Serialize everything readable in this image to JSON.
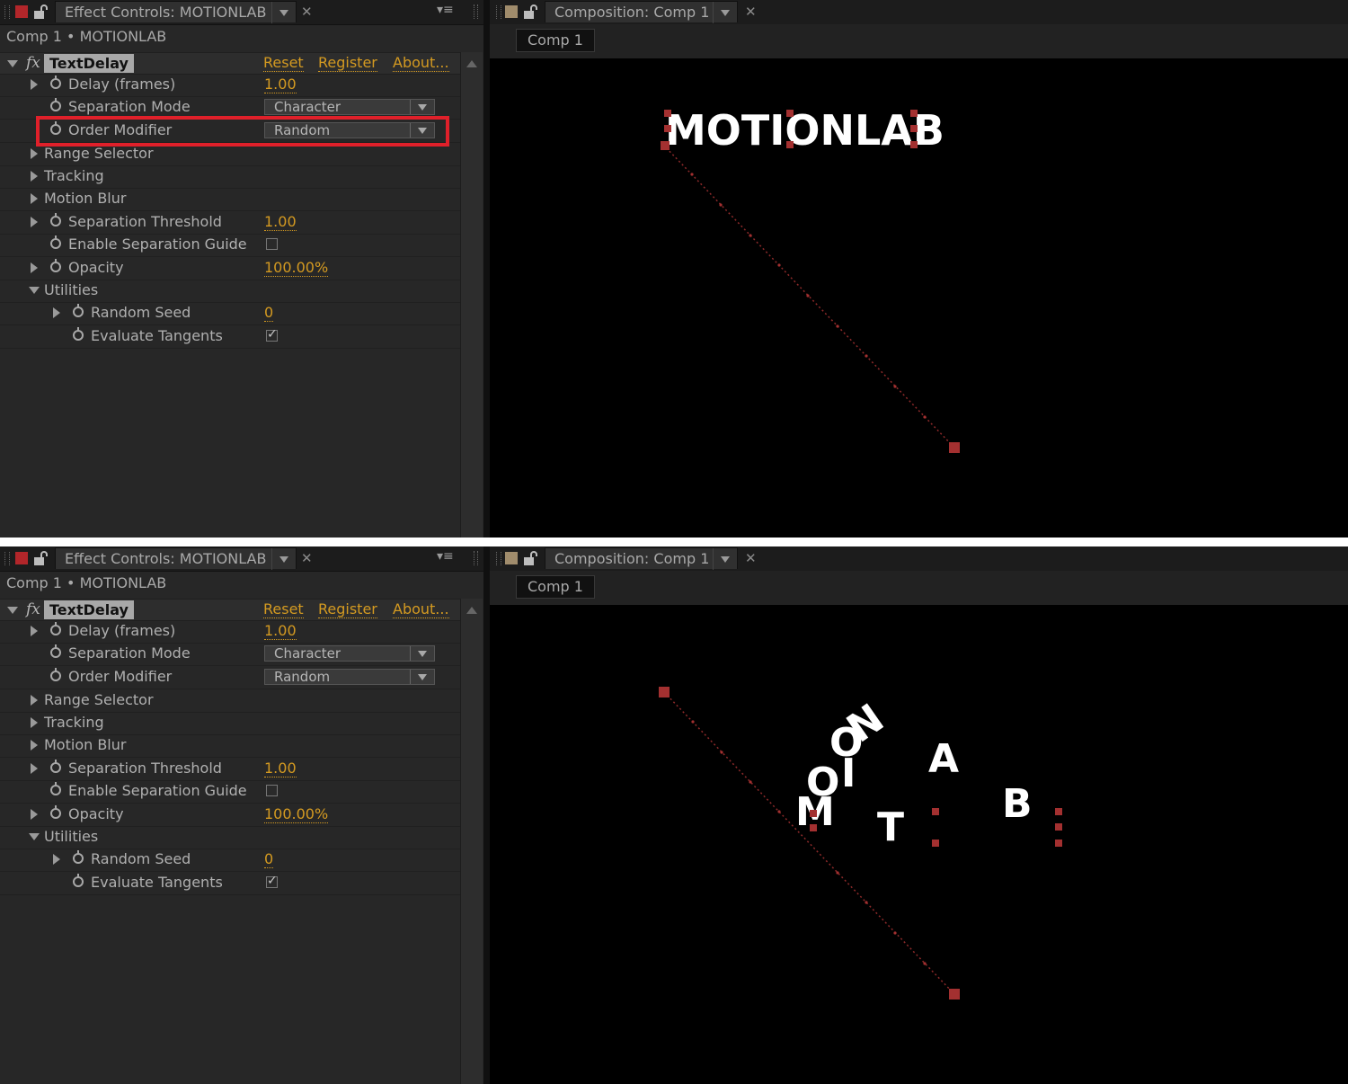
{
  "colors": {
    "accent": "#d49a21",
    "highlight": "#e0202a",
    "path": "#c03030"
  },
  "panels": [
    {
      "effect_controls": {
        "tab_title": "Effect Controls: MOTIONLAB",
        "subtitle": "Comp 1 • MOTIONLAB",
        "effect_name": "TextDelay",
        "links": {
          "reset": "Reset",
          "register": "Register",
          "about": "About..."
        },
        "props": {
          "delay_label": "Delay (frames)",
          "delay_value": "1.00",
          "sep_mode_label": "Separation Mode",
          "sep_mode_value": "Character",
          "order_label": "Order Modifier",
          "order_value": "Random",
          "range_label": "Range Selector",
          "tracking_label": "Tracking",
          "blur_label": "Motion Blur",
          "threshold_label": "Separation Threshold",
          "threshold_value": "1.00",
          "guide_label": "Enable Separation Guide",
          "guide_checked": false,
          "opacity_label": "Opacity",
          "opacity_value": "100.00%",
          "utilities_label": "Utilities",
          "seed_label": "Random Seed",
          "seed_value": "0",
          "tangents_label": "Evaluate Tangents",
          "tangents_checked": true
        },
        "order_highlighted": true
      },
      "composition": {
        "tab_title": "Composition: Comp 1",
        "comp_name": "Comp 1",
        "text": "MOTIONLAB"
      }
    },
    {
      "effect_controls": {
        "tab_title": "Effect Controls: MOTIONLAB",
        "subtitle": "Comp 1 • MOTIONLAB",
        "effect_name": "TextDelay",
        "links": {
          "reset": "Reset",
          "register": "Register",
          "about": "About..."
        },
        "props": {
          "delay_label": "Delay (frames)",
          "delay_value": "1.00",
          "sep_mode_label": "Separation Mode",
          "sep_mode_value": "Character",
          "order_label": "Order Modifier",
          "order_value": "Random",
          "range_label": "Range Selector",
          "tracking_label": "Tracking",
          "blur_label": "Motion Blur",
          "threshold_label": "Separation Threshold",
          "threshold_value": "1.00",
          "guide_label": "Enable Separation Guide",
          "guide_checked": false,
          "opacity_label": "Opacity",
          "opacity_value": "100.00%",
          "utilities_label": "Utilities",
          "seed_label": "Random Seed",
          "seed_value": "0",
          "tangents_label": "Evaluate Tangents",
          "tangents_checked": true
        },
        "order_highlighted": false
      },
      "composition": {
        "tab_title": "Composition: Comp 1",
        "comp_name": "Comp 1",
        "letters": {
          "m": "M",
          "o1": "O",
          "t": "T",
          "i": "I",
          "o2": "O",
          "n": "N",
          "a": "A",
          "b": "B"
        }
      }
    }
  ]
}
